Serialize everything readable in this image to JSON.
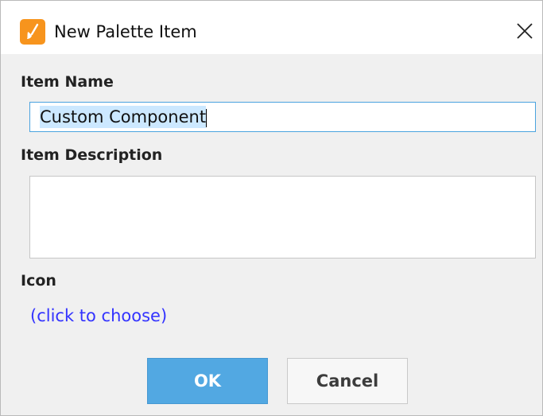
{
  "window": {
    "title": "New Palette Item",
    "icon": "brush-icon",
    "close_icon": "close-icon"
  },
  "form": {
    "item_name_label": "Item Name",
    "item_name_value": "Custom Component",
    "item_description_label": "Item Description",
    "item_description_value": "",
    "icon_label": "Icon",
    "icon_choose_link": "(click to choose)"
  },
  "buttons": {
    "ok_label": "OK",
    "cancel_label": "Cancel"
  },
  "colors": {
    "accent": "#52a8e2",
    "link": "#3333ff",
    "app_icon": "#f7941d",
    "selection": "#cce8ff"
  }
}
